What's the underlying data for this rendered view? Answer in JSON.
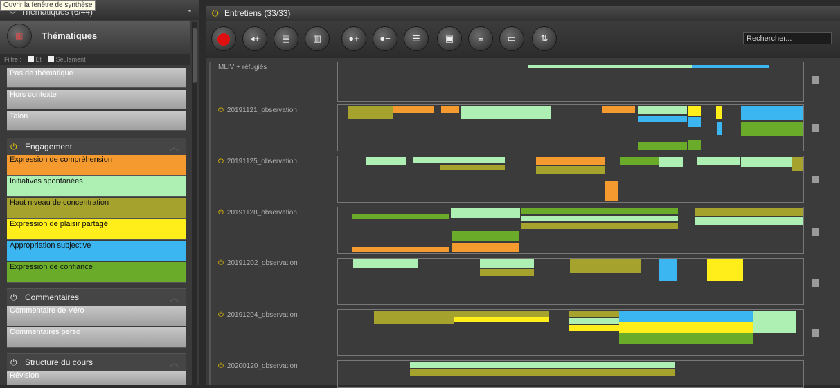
{
  "tooltip": "Ouvrir la fenêtre de synthèse",
  "left_panel": {
    "header": {
      "title": "Thématiques (6/44)",
      "collapse": "-"
    },
    "theme_button": {
      "label": "Thématiques",
      "icon": "grid-icon"
    },
    "filter": {
      "label": "Filtre :",
      "and": "Et",
      "only": "Seulement"
    },
    "tiles_top": [
      {
        "label": "Pas de thématique"
      },
      {
        "label": "Hors contexte"
      },
      {
        "label": "Talon"
      }
    ],
    "sections": [
      {
        "label": "Engagement"
      },
      {
        "label": "Commentaires"
      },
      {
        "label": "Structure du cours"
      }
    ],
    "engagement_items": [
      {
        "label": "Expression de compréhension",
        "color": "#f59a2e"
      },
      {
        "label": "Initiatives spontanées",
        "color": "#aef0b4"
      },
      {
        "label": "Haut niveau de concentration",
        "color": "#a6a22e"
      },
      {
        "label": "Expression de plaisir partagé",
        "color": "#ffee1a"
      },
      {
        "label": "Appropriation subjective",
        "color": "#3cb6f0"
      },
      {
        "label": "Expression de confiance",
        "color": "#6aac2a"
      }
    ],
    "comment_items": [
      {
        "label": "Commentaire de Véro"
      },
      {
        "label": "Commentaires perso"
      }
    ],
    "structure_items": [
      {
        "label": "Révision"
      }
    ]
  },
  "right_panel": {
    "header": {
      "title": "Entretiens (33/33)"
    },
    "search_placeholder": "Rechercher...",
    "toolbar_icons": [
      "record-icon",
      "audio-add-icon",
      "file-add-icon",
      "doc-add-icon",
      "person-add-icon",
      "person-remove-icon",
      "list-icon",
      "image-edit-icon",
      "highlight-icon",
      "window-icon",
      "sort-icon"
    ],
    "rows": [
      {
        "label": "MLIV + réfugiés",
        "has_power": false
      },
      {
        "label": "20191121_observation",
        "has_power": true
      },
      {
        "label": "20191125_observation",
        "has_power": true
      },
      {
        "label": "20191128_observation",
        "has_power": true
      },
      {
        "label": "20191202_observation",
        "has_power": true
      },
      {
        "label": "20191204_observation",
        "has_power": true
      },
      {
        "label": "20200120_observation",
        "has_power": true
      }
    ]
  }
}
